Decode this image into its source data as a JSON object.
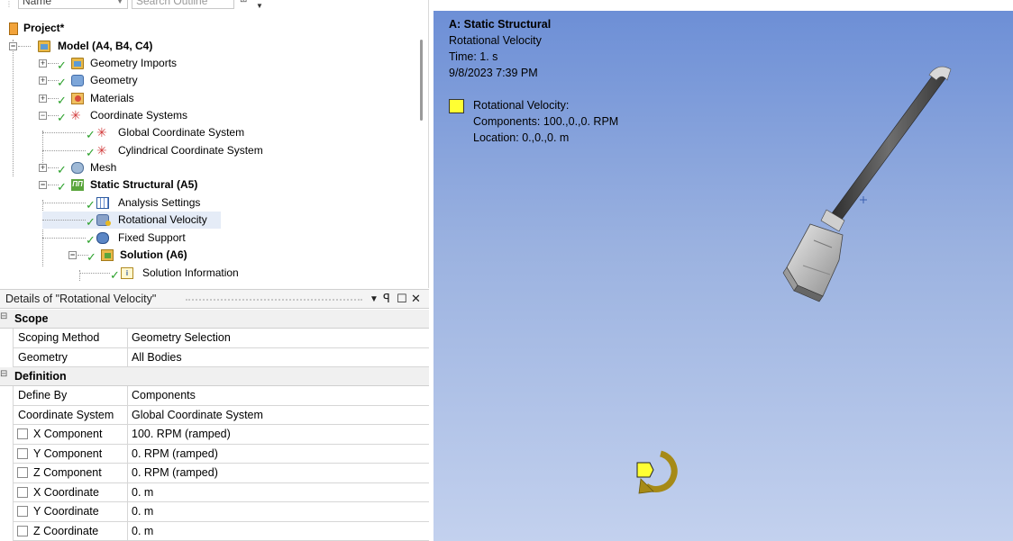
{
  "outline": {
    "name_header": "Name",
    "search_placeholder": "Search Outline",
    "tree": [
      {
        "label": "Project*",
        "bold": true
      },
      {
        "label": "Model (A4, B4, C4)",
        "bold": true
      },
      {
        "label": "Geometry Imports"
      },
      {
        "label": "Geometry"
      },
      {
        "label": "Materials"
      },
      {
        "label": "Coordinate Systems"
      },
      {
        "label": "Global Coordinate System"
      },
      {
        "label": "Cylindrical Coordinate System"
      },
      {
        "label": "Mesh"
      },
      {
        "label": "Static Structural (A5)",
        "bold": true
      },
      {
        "label": "Analysis Settings"
      },
      {
        "label": "Rotational Velocity",
        "selected": true
      },
      {
        "label": "Fixed Support"
      },
      {
        "label": "Solution (A6)",
        "bold": true
      },
      {
        "label": "Solution Information"
      }
    ]
  },
  "details": {
    "title": "Details of \"Rotational Velocity\"",
    "sections": [
      {
        "label": "Scope",
        "rows": [
          {
            "name": "Scoping Method",
            "value": "Geometry Selection"
          },
          {
            "name": "Geometry",
            "value": "All Bodies"
          }
        ]
      },
      {
        "label": "Definition",
        "rows": [
          {
            "name": "Define By",
            "value": "Components"
          },
          {
            "name": "Coordinate System",
            "value": "Global Coordinate System"
          },
          {
            "name": "X Component",
            "value": "100. RPM  (ramped)",
            "checkbox": true
          },
          {
            "name": "Y Component",
            "value": "0. RPM  (ramped)",
            "checkbox": true
          },
          {
            "name": "Z Component",
            "value": "0. RPM  (ramped)",
            "checkbox": true
          },
          {
            "name": "X Coordinate",
            "value": "0. m",
            "checkbox": true
          },
          {
            "name": "Y Coordinate",
            "value": "0. m",
            "checkbox": true
          },
          {
            "name": "Z Coordinate",
            "value": "0. m",
            "checkbox": true
          }
        ]
      }
    ]
  },
  "viewport": {
    "title": "A: Static Structural",
    "lines": [
      "Rotational Velocity",
      "Time: 1. s",
      "9/8/2023 7:39 PM"
    ],
    "legend": [
      "Rotational Velocity:",
      "Components: 100.,0.,0. RPM",
      "Location: 0.,0.,0. m"
    ],
    "legend_color": "#ffff33",
    "background_top": "#6d8fd6",
    "background_bottom": "#c3d1ee"
  }
}
